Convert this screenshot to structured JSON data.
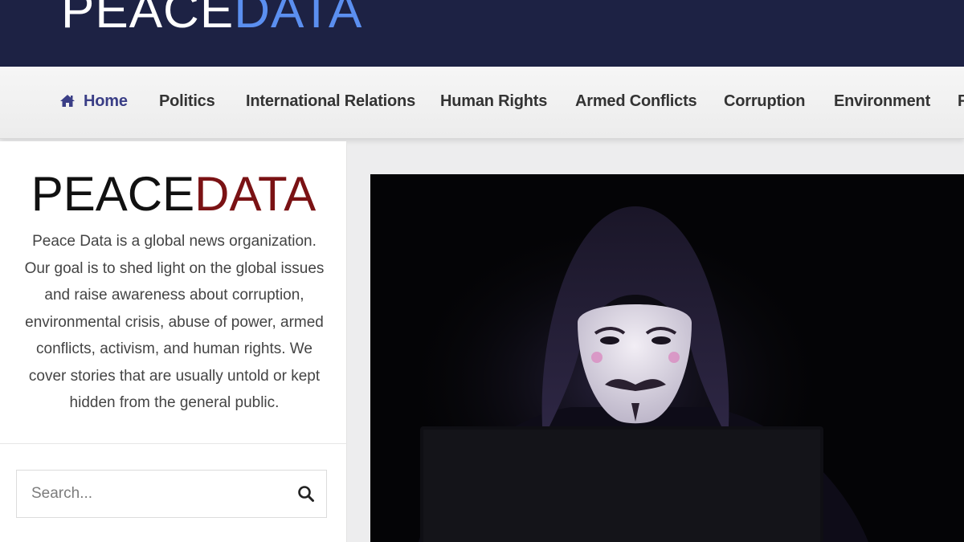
{
  "header": {
    "logo_part1": "PEACE",
    "logo_part2": "DATA"
  },
  "nav": {
    "items": [
      {
        "label": "Home",
        "icon": "home-icon",
        "active": true
      },
      {
        "label": "Politics"
      },
      {
        "label": "International Relations"
      },
      {
        "label": "Human Rights"
      },
      {
        "label": "Armed Conflicts"
      },
      {
        "label": "Corruption"
      },
      {
        "label": "Environment"
      },
      {
        "label": "F"
      }
    ]
  },
  "sidebar": {
    "logo_part1": "PEACE",
    "logo_part2": "DATA",
    "about": "Peace Data is a global news organization. Our goal is to shed light on the global issues and raise awareness about corruption, environmental crisis, abuse of power, armed conflicts, activism, and human rights. We cover stories that are usually untold or kept hidden from the general public."
  },
  "search": {
    "placeholder": "Search...",
    "icon": "search-icon"
  },
  "hero": {
    "image": "hooded-figure-guy-fawkes-mask-laptop"
  },
  "colors": {
    "topbar": "#1d2244",
    "logo_accent": "#5b8ff0",
    "sidebar_logo_accent": "#7a1214",
    "nav_active": "#3a3e86"
  }
}
